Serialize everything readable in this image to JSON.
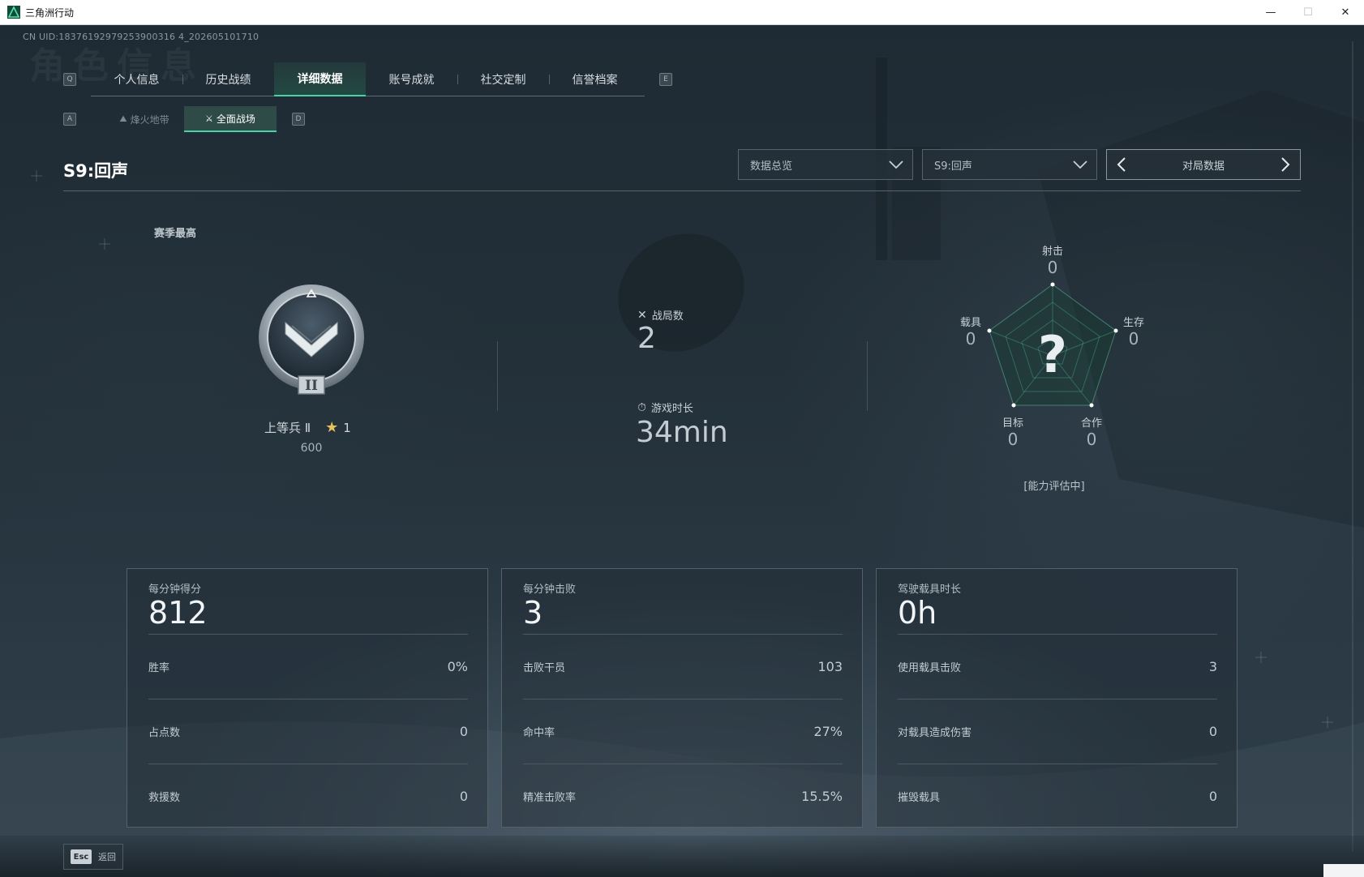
{
  "window": {
    "title": "三角洲行动",
    "minimize": "—",
    "maximize": "☐",
    "close": "✕"
  },
  "uid": "CN UID:18376192979253900316 4_202605101710",
  "header": {
    "ghost_title": "角色信息",
    "key_left": "Q",
    "key_right": "E",
    "tabs": [
      {
        "label": "个人信息"
      },
      {
        "label": "历史战绩"
      },
      {
        "label": "详细数据"
      },
      {
        "label": "账号成就"
      },
      {
        "label": "社交定制"
      },
      {
        "label": "信誉档案"
      }
    ],
    "sub_key_left": "A",
    "sub_key_right": "D",
    "subtabs": [
      {
        "label": "烽火地带"
      },
      {
        "label": "全面战场"
      }
    ]
  },
  "season_title": "S9:回声",
  "filters": {
    "overview": "数据总览",
    "season": "S9:回声",
    "match_data": "对局数据"
  },
  "rank": {
    "section_label": "赛季最高",
    "name": "上等兵 Ⅱ",
    "stars": "1",
    "points": "600",
    "tier_roman": "II"
  },
  "summary": {
    "matches_label": "战局数",
    "matches_value": "2",
    "time_label": "游戏时长",
    "time_value": "34min"
  },
  "radar": {
    "center_mark": "?",
    "axes": [
      {
        "label": "射击",
        "value": "0"
      },
      {
        "label": "生存",
        "value": "0"
      },
      {
        "label": "合作",
        "value": "0"
      },
      {
        "label": "目标",
        "value": "0"
      },
      {
        "label": "载具",
        "value": "0"
      }
    ],
    "status": "[能力评估中]"
  },
  "cards": [
    {
      "head_label": "每分钟得分",
      "head_value": "812",
      "rows": [
        {
          "label": "胜率",
          "value": "0%"
        },
        {
          "label": "占点数",
          "value": "0"
        },
        {
          "label": "救援数",
          "value": "0"
        }
      ]
    },
    {
      "head_label": "每分钟击败",
      "head_value": "3",
      "rows": [
        {
          "label": "击败干员",
          "value": "103"
        },
        {
          "label": "命中率",
          "value": "27%"
        },
        {
          "label": "精准击败率",
          "value": "15.5%"
        }
      ]
    },
    {
      "head_label": "驾驶载具时长",
      "head_value": "0h",
      "rows": [
        {
          "label": "使用载具击败",
          "value": "3"
        },
        {
          "label": "对载具造成伤害",
          "value": "0"
        },
        {
          "label": "摧毁载具",
          "value": "0"
        }
      ]
    }
  ],
  "footer": {
    "esc_key": "Esc",
    "back_label": "返回"
  },
  "colors": {
    "accent": "#4ad1a4",
    "background": "#1f2b34",
    "star": "#e4c35a"
  }
}
